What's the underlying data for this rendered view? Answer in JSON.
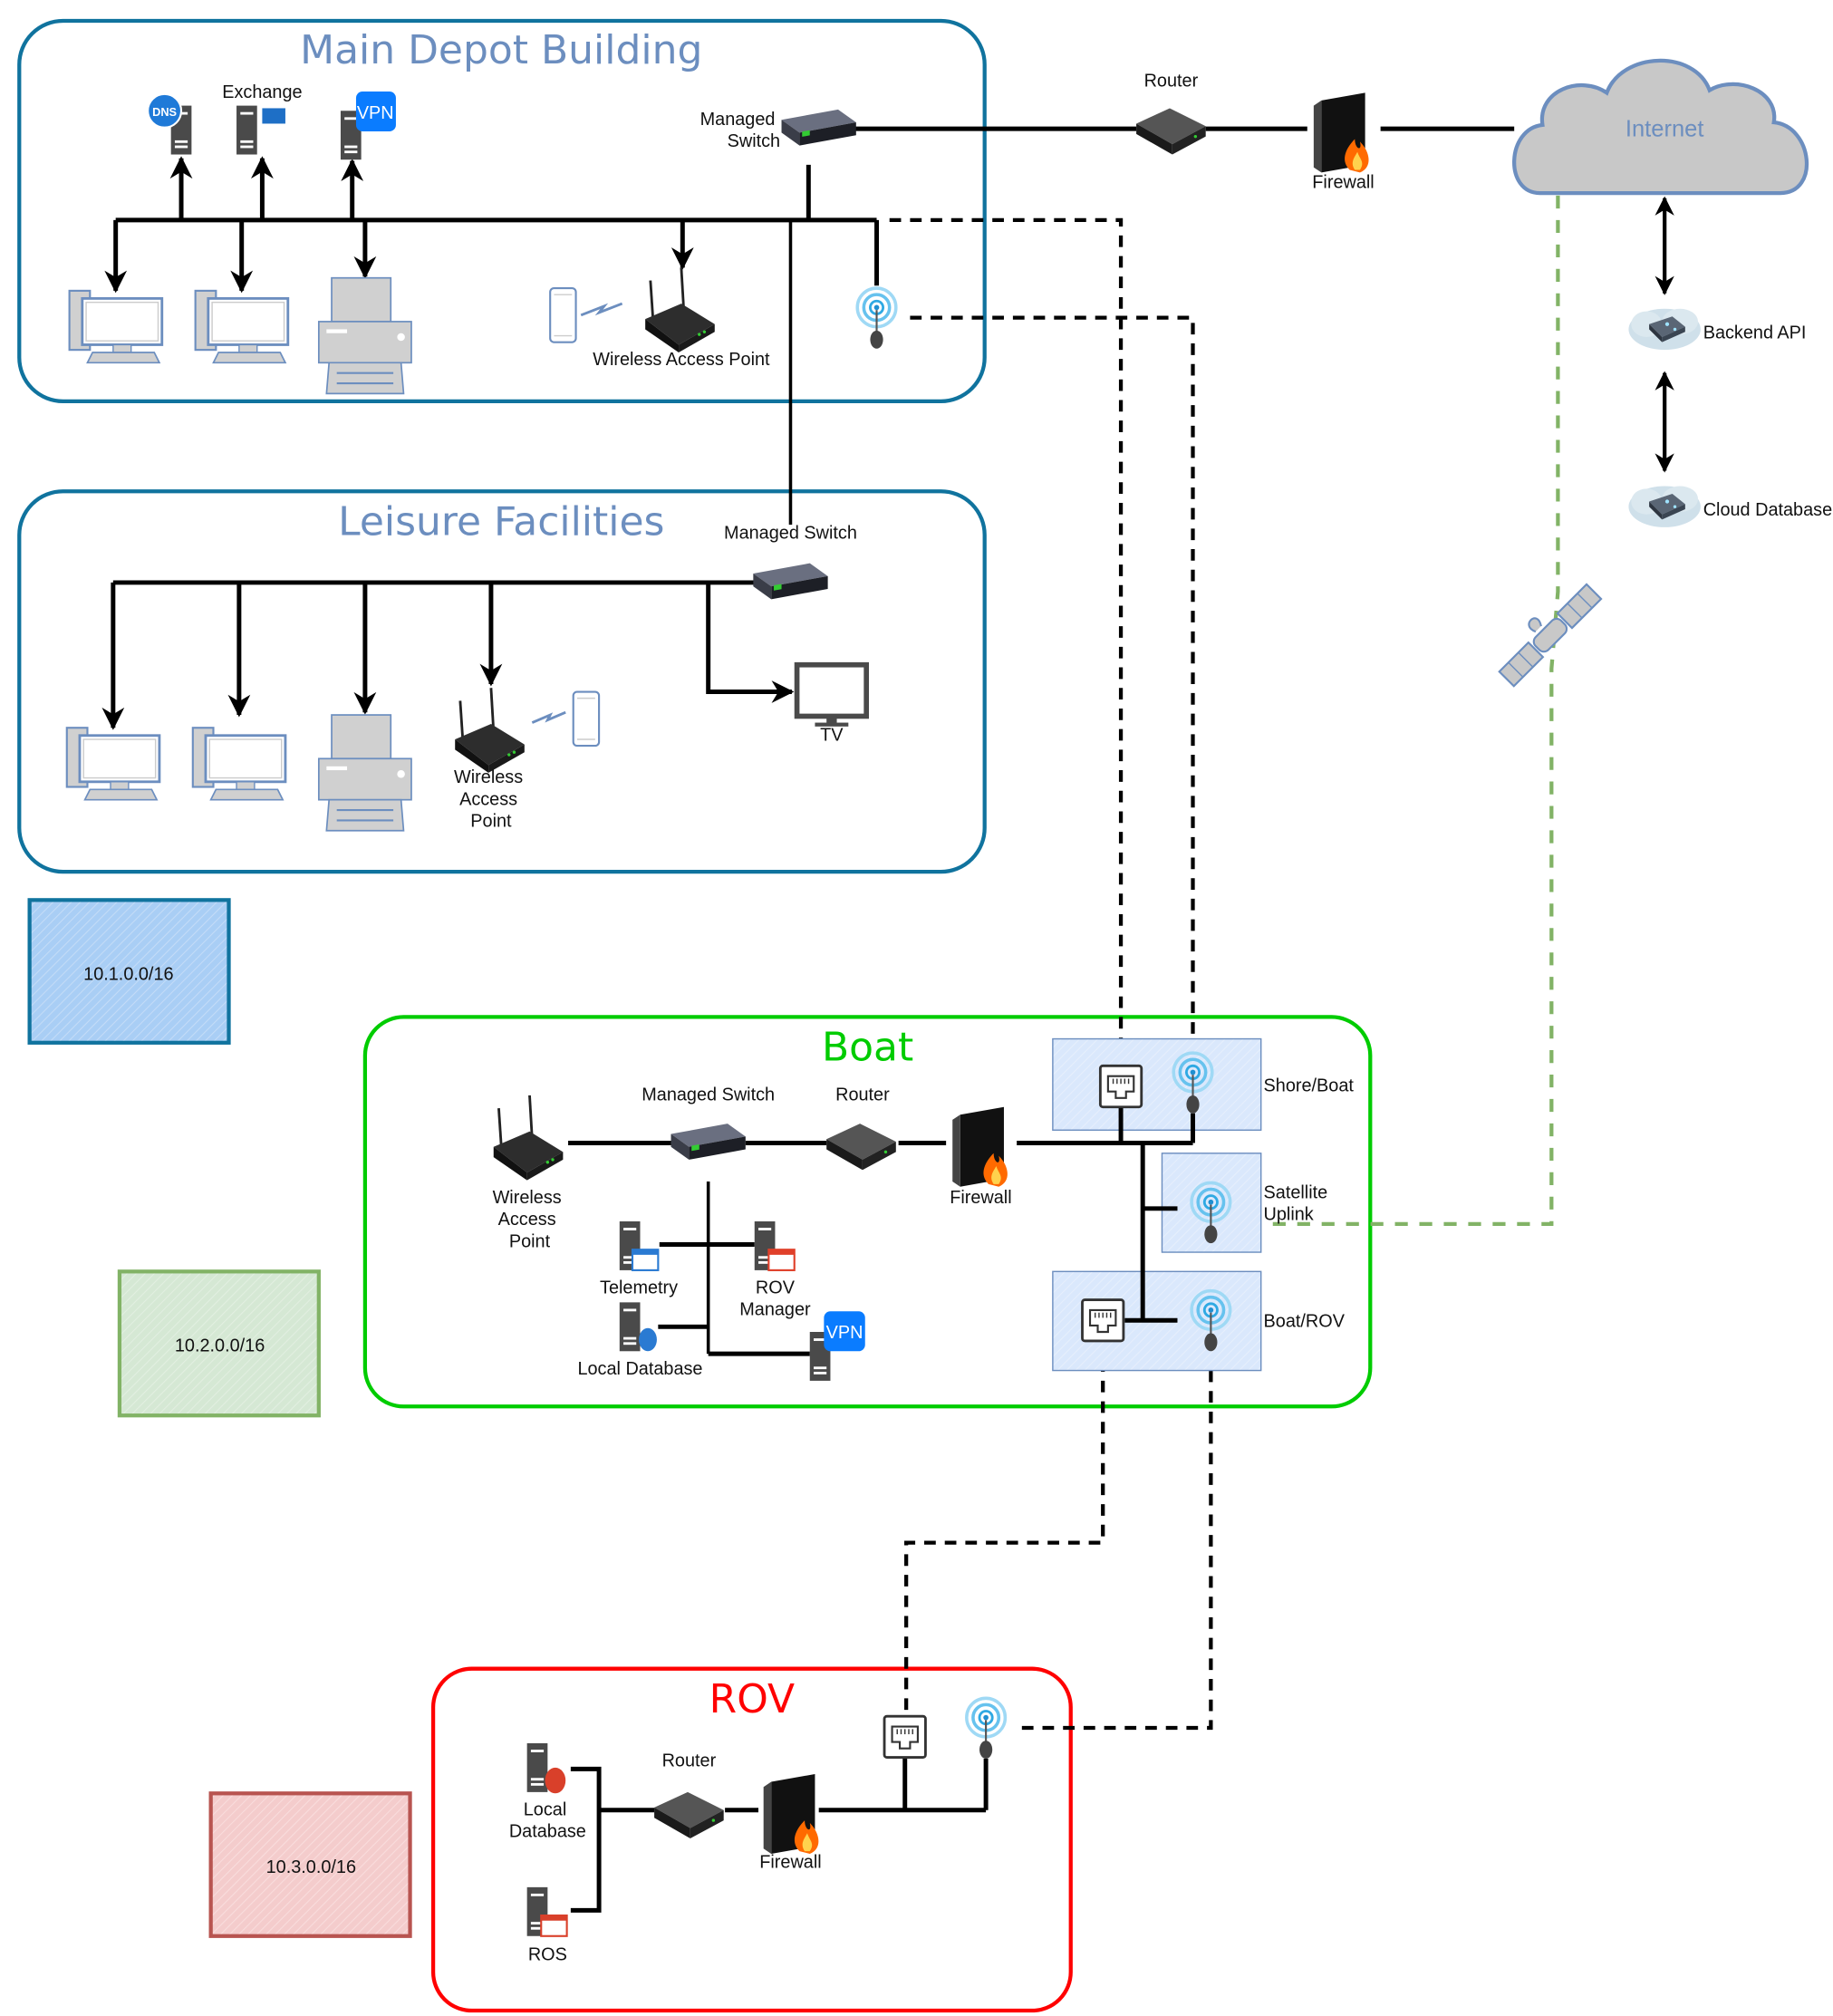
{
  "diagram": {
    "zones": {
      "main_depot": {
        "title": "Main Depot Building",
        "color": "#10739e",
        "title_color": "#6c8ebf"
      },
      "leisure": {
        "title": "Leisure Facilities",
        "color": "#10739e",
        "title_color": "#6c8ebf"
      },
      "boat": {
        "title": "Boat",
        "color": "#00cc00",
        "title_color": "#00cc00"
      },
      "rov": {
        "title": "ROV",
        "color": "#ff0000",
        "title_color": "#ff0000"
      }
    },
    "subnets": [
      {
        "label": "10.1.0.0/16",
        "fill": "#a9cef5",
        "stroke": "#10739e"
      },
      {
        "label": "10.2.0.0/16",
        "fill": "#d5e8d4",
        "stroke": "#82b366"
      },
      {
        "label": "10.3.0.0/16",
        "fill": "#f8cecc",
        "stroke": "#b85450"
      }
    ],
    "main_depot": {
      "dns_server": "DNS",
      "exchange_label": "Exchange",
      "vpn_badge": "VPN",
      "switch_label_1": "Managed",
      "switch_label_2": "Switch",
      "wap_label": "Wireless Access Point"
    },
    "external": {
      "router_label": "Router",
      "firewall_label": "Firewall",
      "internet_label": "Internet",
      "backend_api_label": "Backend API",
      "cloud_db_label": "Cloud Database"
    },
    "leisure": {
      "switch_label": "Managed Switch",
      "wap_label_1": "Wireless",
      "wap_label_2": "Access",
      "wap_label_3": "Point",
      "tv_label": "TV"
    },
    "boat": {
      "wap_label_1": "Wireless",
      "wap_label_2": "Access",
      "wap_label_3": "Point",
      "switch_label": "Managed Switch",
      "router_label": "Router",
      "firewall_label": "Firewall",
      "telemetry_label": "Telemetry",
      "rov_manager_label_1": "ROV",
      "rov_manager_label_2": "Manager",
      "local_db_label": "Local Database",
      "vpn_badge": "VPN",
      "link_shore_boat": "Shore/Boat",
      "link_satellite_1": "Satellite",
      "link_satellite_2": "Uplink",
      "link_boat_rov": "Boat/ROV"
    },
    "rov": {
      "local_db_label_1": "Local",
      "local_db_label_2": "Database",
      "ros_label": "ROS",
      "router_label": "Router",
      "firewall_label": "Firewall"
    }
  }
}
